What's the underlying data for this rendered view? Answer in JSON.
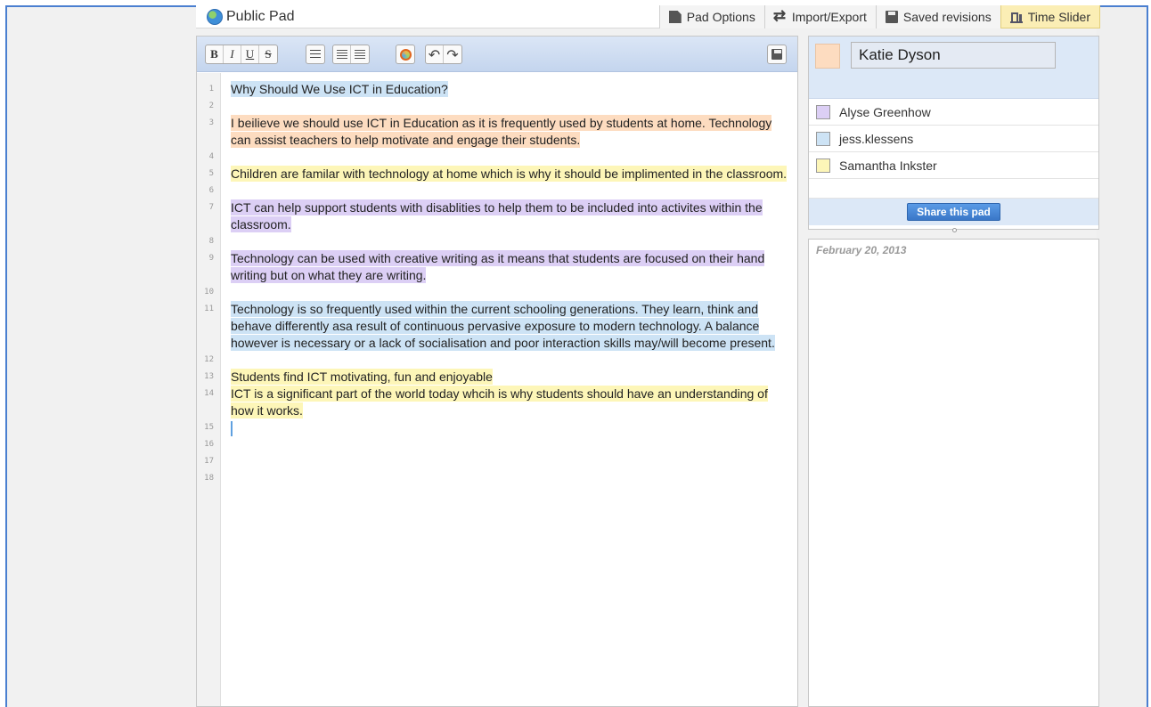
{
  "header": {
    "title": "Public Pad",
    "nav": [
      {
        "label": "Pad Options",
        "icon": "document-icon"
      },
      {
        "label": "Import/Export",
        "icon": "swap-arrows-icon"
      },
      {
        "label": "Saved revisions",
        "icon": "floppy-disk-icon"
      },
      {
        "label": "Time Slider",
        "icon": "time-slider-icon"
      }
    ]
  },
  "toolbar": {
    "bold": "B",
    "italic": "I",
    "underline": "U",
    "strike": "S"
  },
  "document": {
    "lines": [
      {
        "num": "1",
        "text": "Why Should We Use ICT in Education?",
        "author": "blue"
      },
      {
        "num": "2",
        "text": "",
        "author": ""
      },
      {
        "num": "3",
        "text": "I beilieve we should use ICT in Education as it is frequently used by students at home. Technology can assist teachers to help motivate and engage their students.",
        "author": "orange"
      },
      {
        "num": "4",
        "text": "",
        "author": ""
      },
      {
        "num": "5",
        "text": "Children are familar with technology at home which is why it should be implimented in the classroom.",
        "author": "yellow"
      },
      {
        "num": "6",
        "text": "",
        "author": ""
      },
      {
        "num": "7",
        "text": "ICT can help support students with disablities to help them to be included into activites within the classroom.",
        "author": "purple"
      },
      {
        "num": "8",
        "text": "",
        "author": ""
      },
      {
        "num": "9",
        "text": "Technology can be used with creative writing as it means that students are focused on their hand writing but on what they are writing.",
        "author": "purple"
      },
      {
        "num": "10",
        "text": "",
        "author": ""
      },
      {
        "num": "11",
        "text": "Technology is so frequently used within the current schooling generations.  They learn, think and behave differently asa result of continuous pervasive exposure to modern technology.  A balance however is necessary or a lack of socialisation and poor interaction skills may/will become present.",
        "author": "blue"
      },
      {
        "num": "12",
        "text": "",
        "author": ""
      },
      {
        "num": "13",
        "text": "Students find ICT motivating, fun and enjoyable",
        "author": "yellow"
      },
      {
        "num": "14",
        "text": "ICT is a significant part of the world today whcih is why students should have an understanding of how it works.",
        "author": "yellow"
      },
      {
        "num": "15",
        "text": "",
        "author": "cursor"
      },
      {
        "num": "16",
        "text": "",
        "author": ""
      },
      {
        "num": "17",
        "text": "",
        "author": ""
      },
      {
        "num": "18",
        "text": "",
        "author": ""
      }
    ]
  },
  "users": {
    "me": {
      "name": "Katie Dyson",
      "color": "#fddcc0"
    },
    "others": [
      {
        "name": "Alyse Greenhow",
        "color": "#dccff5"
      },
      {
        "name": "jess.klessens",
        "color": "#cde3f5"
      },
      {
        "name": "Samantha Inkster",
        "color": "#fdf6b8"
      }
    ],
    "share_label": "Share this pad"
  },
  "chat": {
    "date": "February 20, 2013"
  },
  "colors": {
    "blue": "#cde3f5",
    "orange": "#fddcc0",
    "yellow": "#fdf6b8",
    "purple": "#dccff5"
  }
}
